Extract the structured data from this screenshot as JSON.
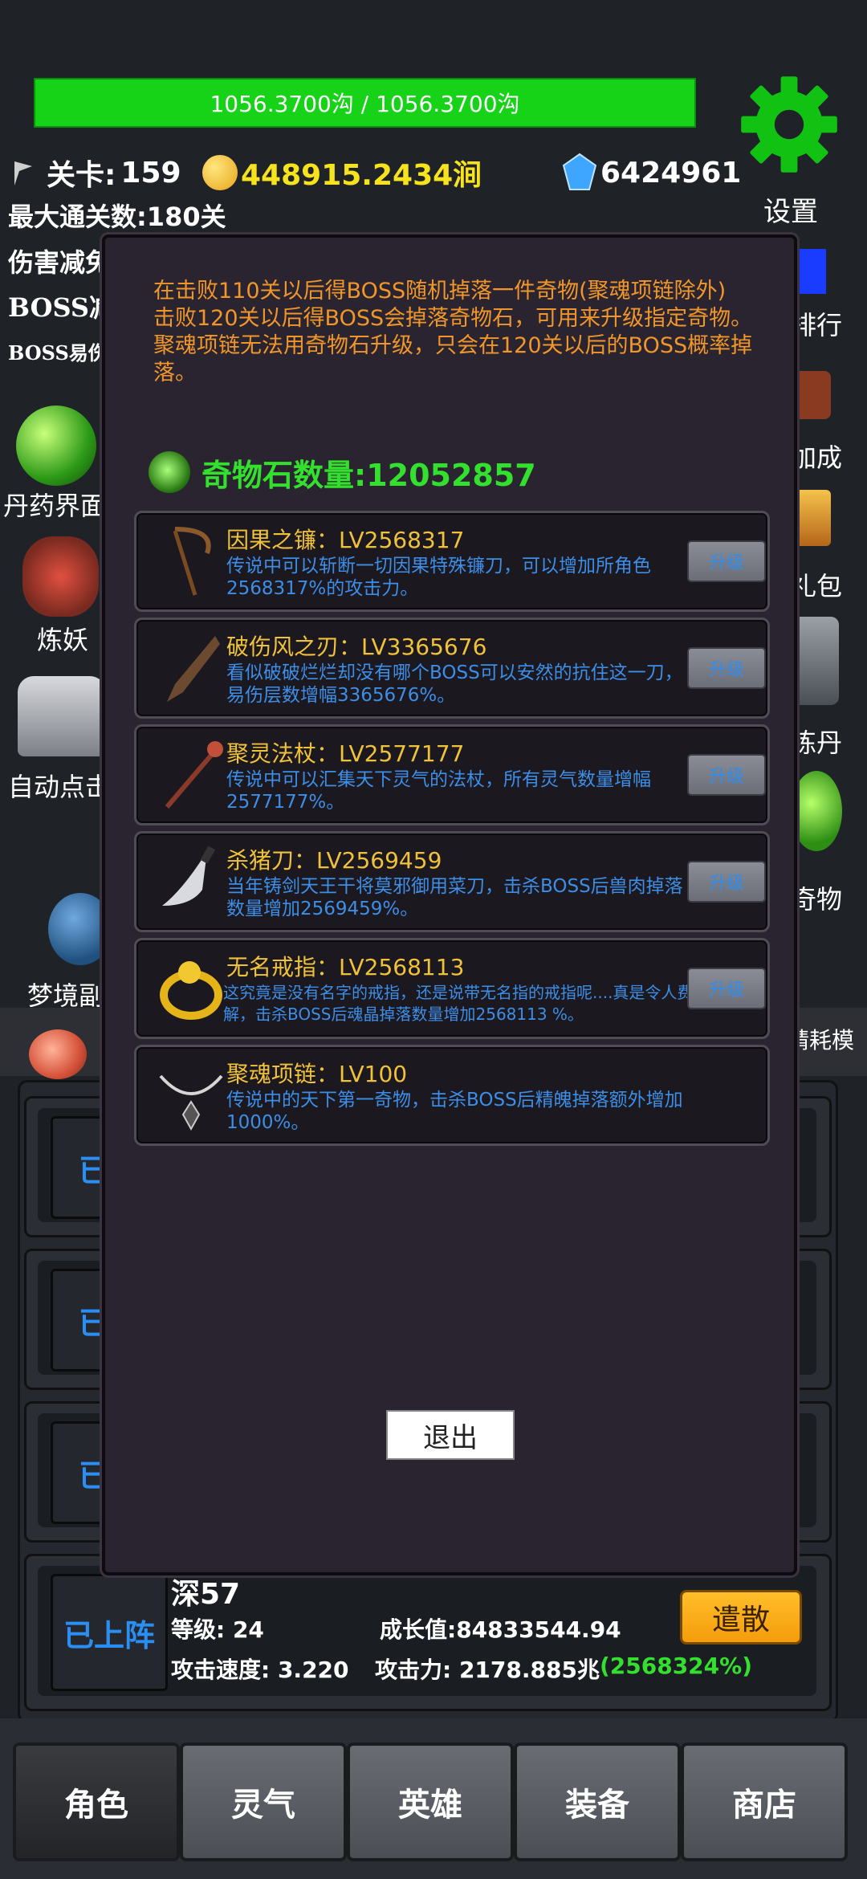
{
  "hp_bar": "1056.3700沟 / 1056.3700沟",
  "settings_label": "设置",
  "stats": {
    "level_label": "关卡:",
    "level_value": "159",
    "gold": "448915.2434涧",
    "gems": "6424961",
    "max_level": "最大通关数:180关"
  },
  "left_menu": {
    "damage_label": "伤害减免",
    "boss_label": "BOSS减",
    "boss_small": "BOSS易伤",
    "pill": "丹药界面",
    "demon": "炼妖",
    "auto": "自动点击",
    "dream": "梦境副"
  },
  "right_menu": {
    "rank": "排行",
    "bonus": "加成",
    "gift": "礼包",
    "dan": "练丹",
    "item": "奇物",
    "consume": "精耗模"
  },
  "modal": {
    "desc1": "在击败110关以后得BOSS随机掉落一件奇物(聚魂项链除外)",
    "desc2": "击败120关以后得BOSS会掉落奇物石，可用来升级指定奇物。",
    "desc3": "聚魂项链无法用奇物石升级，只会在120关以后的BOSS概率掉落。",
    "stone_count": "奇物石数量:12052857",
    "items": [
      {
        "title": "因果之镰：LV2568317",
        "desc": "传说中可以斩断一切因果特殊镰刀，可以增加所角色2568317%的攻击力。",
        "button": "升级"
      },
      {
        "title": "破伤风之刃：LV3365676",
        "desc": "看似破破烂烂却没有哪个BOSS可以安然的抗住这一刀，易伤层数增幅3365676%。",
        "button": "升级"
      },
      {
        "title": "聚灵法杖：LV2577177",
        "desc": "传说中可以汇集天下灵气的法杖，所有灵气数量增幅2577177%。",
        "button": "升级"
      },
      {
        "title": "杀猪刀：LV2569459",
        "desc": "当年铸剑天王干将莫邪御用菜刀，击杀BOSS后兽肉掉落数量增加2569459%。",
        "button": "升级"
      },
      {
        "title": "无名戒指：LV2568113",
        "desc": "这究竟是没有名字的戒指，还是说带无名指的戒指呢....真是令人费解，击杀BOSS后魂晶掉落数量增加2568113 %。",
        "button": "升级"
      },
      {
        "title": "聚魂项链：LV100",
        "desc": "传说中的天下第一奇物，击杀BOSS后精魄掉落额外增加1000%。",
        "button": ""
      }
    ],
    "exit": "退出"
  },
  "list": {
    "onstage": "已上阵",
    "onstage_short": "已上",
    "hero_name": "深57",
    "level": "等级: 24",
    "growth": "成长值:84833544.94",
    "speed": "攻击速度: 3.220",
    "attack": "攻击力: 2178.885兆",
    "attack_bonus": "(2568324%)",
    "dismiss": "遣散"
  },
  "nav": [
    "角色",
    "灵气",
    "英雄",
    "装备",
    "商店"
  ],
  "colors": {
    "accent_green": "#34e02e",
    "gold": "#f7e21e",
    "orange": "#f0962a",
    "blue": "#2e8ef0"
  }
}
